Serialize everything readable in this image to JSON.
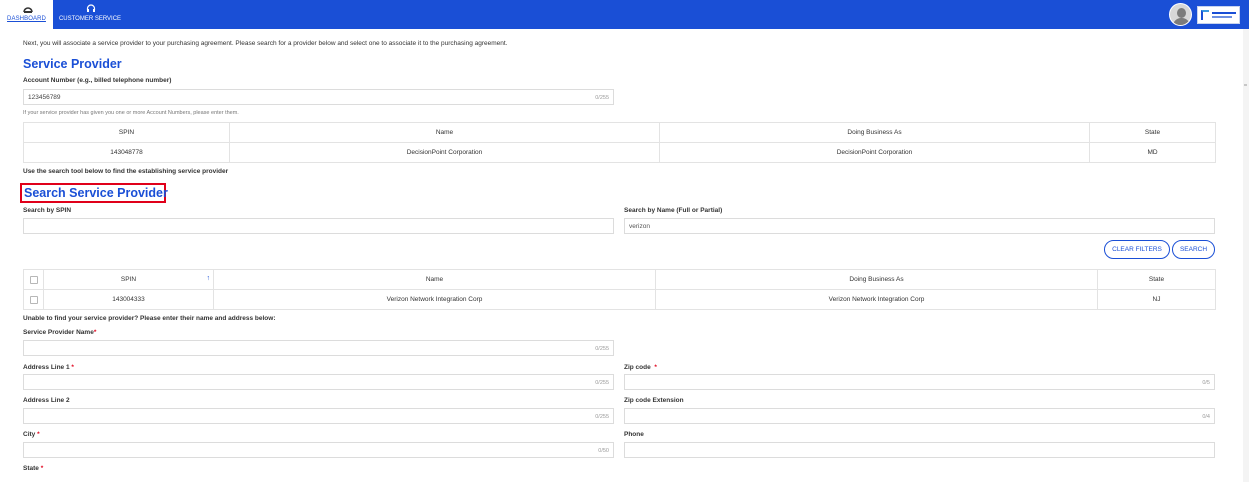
{
  "nav": {
    "dashboard_label": "DASHBOARD",
    "customer_service_label": "CUSTOMER SERVICE",
    "dashboard_icon": "dashboard-gauge-icon",
    "customer_service_icon": "headset-icon"
  },
  "intro_text": "Next, you will associate a service provider to your purchasing agreement. Please search for a provider below and select one to associate it to the purchasing agreement.",
  "service_provider": {
    "title": "Service Provider",
    "account_label": "Account Number (e.g., billed telephone number)",
    "account_value": "123456789",
    "account_counter": "0/255",
    "account_hint": "If your service provider has given you one or more Account Numbers, please enter them.",
    "table": {
      "headers": [
        "SPIN",
        "Name",
        "Doing Business As",
        "State"
      ],
      "rows": [
        [
          "143048778",
          "DecisionPoint Corporation",
          "DecisionPoint Corporation",
          "MD"
        ]
      ]
    },
    "search_tool_note": "Use the search tool below to find the establishing service provider"
  },
  "search": {
    "title": "Search Service Provider",
    "spin_label": "Search by SPIN",
    "spin_value": "",
    "name_label": "Search by Name (Full or Partial)",
    "name_value": "verizon",
    "clear_filters_label": "CLEAR FILTERS",
    "search_label": "SEARCH",
    "results": {
      "headers": [
        "SPIN",
        "Name",
        "Doing Business As",
        "State"
      ],
      "sort_indicator": "↑",
      "rows": [
        [
          "143004333",
          "Verizon Network Integration Corp",
          "Verizon Network Integration Corp",
          "NJ"
        ]
      ]
    }
  },
  "manual_entry": {
    "prompt": "Unable to find your service provider? Please enter their name and address below:",
    "required_mark": "*",
    "provider_name_label": "Service Provider Name",
    "provider_name_counter": "0/255",
    "address1_label": "Address Line 1",
    "address1_counter": "0/255",
    "zip_label": "Zip code",
    "zip_counter": "0/5",
    "address2_label": "Address Line 2",
    "address2_counter": "0/255",
    "zip_ext_label": "Zip code Extension",
    "zip_ext_counter": "0/4",
    "city_label": "City",
    "city_counter": "0/50",
    "phone_label": "Phone",
    "state_label": "State"
  },
  "colors": {
    "brand_blue": "#1a4fd6",
    "highlight_red": "#e0001a"
  }
}
